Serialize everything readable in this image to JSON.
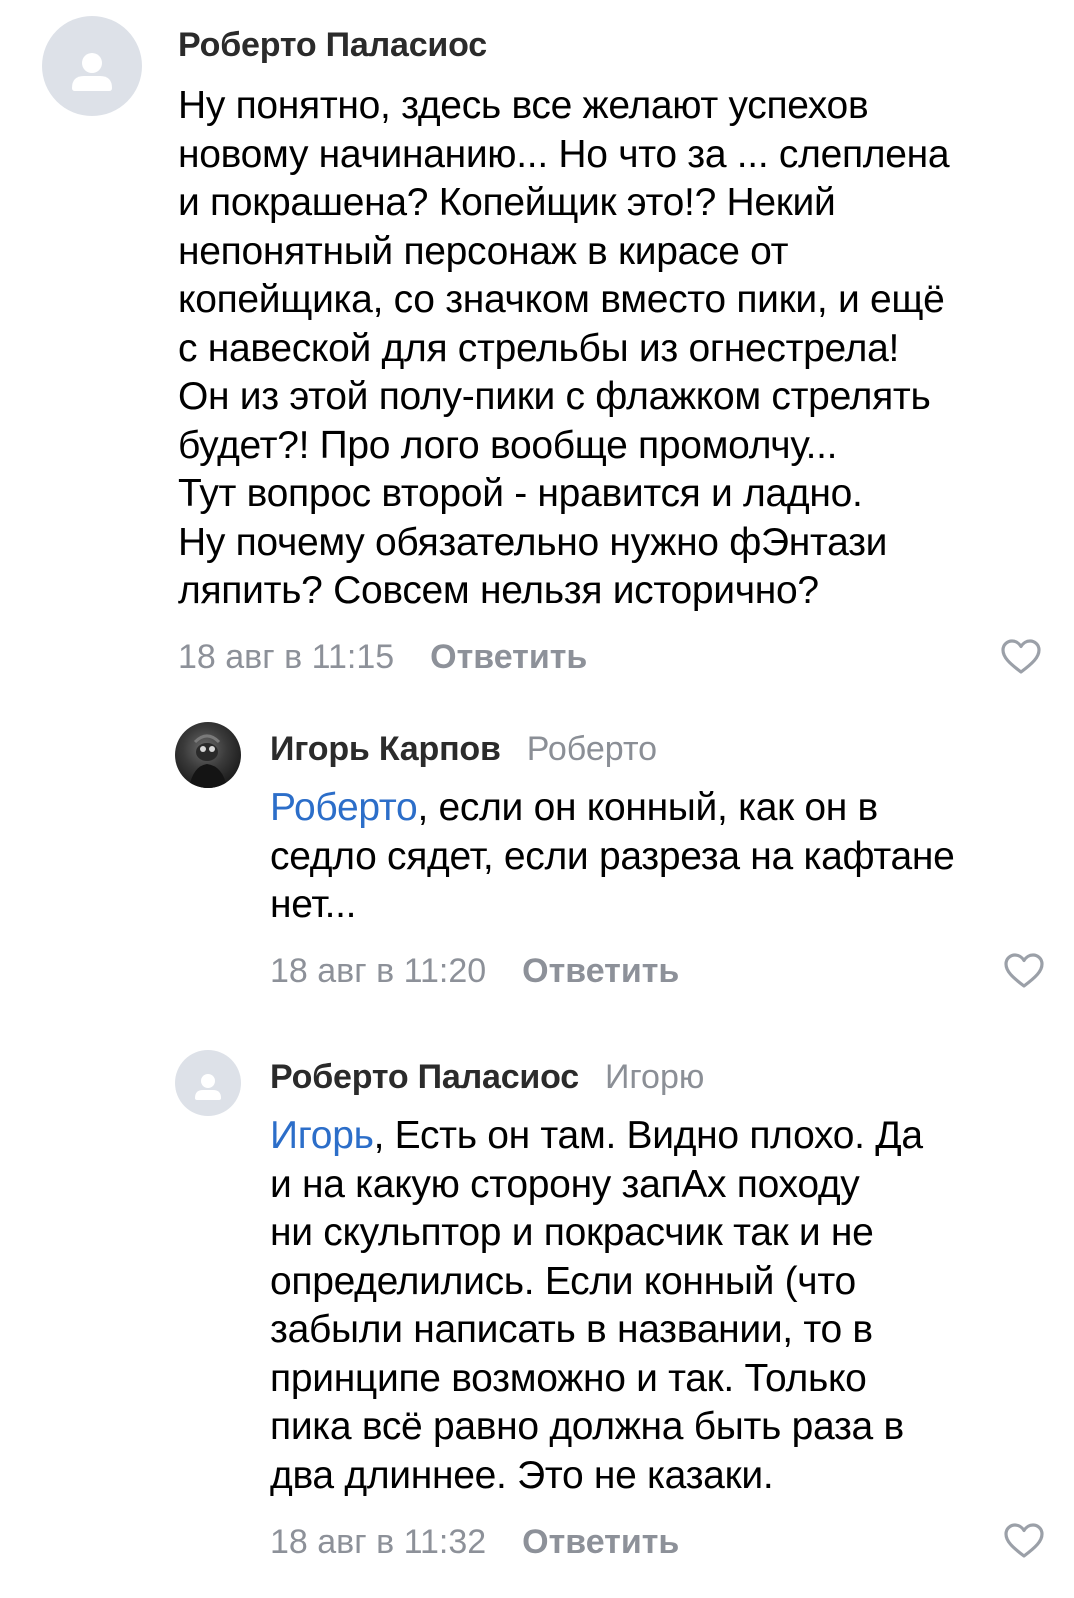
{
  "comments": [
    {
      "author": "Роберто Паласиос",
      "reply_to": "",
      "mention": "",
      "text": "Ну понятно, здесь все желают успехов\nновому начинанию... Но что за ... слеплена\nи покрашена? Копейщик это!? Некий\nнепонятный персонаж в кирасе от\nкопейщика, со значком вместо пики, и ещё\nс навеской для стрельбы из огнестрела!\nОн из этой полу-пики с флажком стрелять\nбудет?! Про лого вообще промолчу...\nТут вопрос второй - нравится и ладно.\nНу почему обязательно нужно фЭнтази\nляпить? Совсем нельзя исторично?",
      "time": "18 авг в 11:15",
      "reply_label": "Ответить",
      "avatar": "placeholder"
    },
    {
      "author": "Игорь Карпов",
      "reply_to": "Роберто",
      "mention": "Роберто",
      "text": ", если он конный, как он в\nседло сядет, если разреза на кафтане\nнет...",
      "time": "18 авг в 11:20",
      "reply_label": "Ответить",
      "avatar": "photo"
    },
    {
      "author": "Роберто Паласиос",
      "reply_to": "Игорю",
      "mention": "Игорь",
      "text": ", Есть он там. Видно плохо. Да\nи на какую сторону запАх походу\nни скульптор и покрасчик так и не\nопределились. Если конный (что\nзабыли написать в названии, то в\nпринципе возможно и так. Только\nпика всё равно должна быть раза в\nдва длиннее. Это не казаки.",
      "time": "18 авг в 11:32",
      "reply_label": "Ответить",
      "avatar": "placeholder"
    }
  ],
  "icons": {
    "like": "heart-outline-icon",
    "avatar_placeholder": "user-silhouette-icon"
  },
  "colors": {
    "mention": "#2c6ec9",
    "meta": "#8d9199",
    "author": "#2b2b2b",
    "avatar_bg": "#dde1e8"
  }
}
